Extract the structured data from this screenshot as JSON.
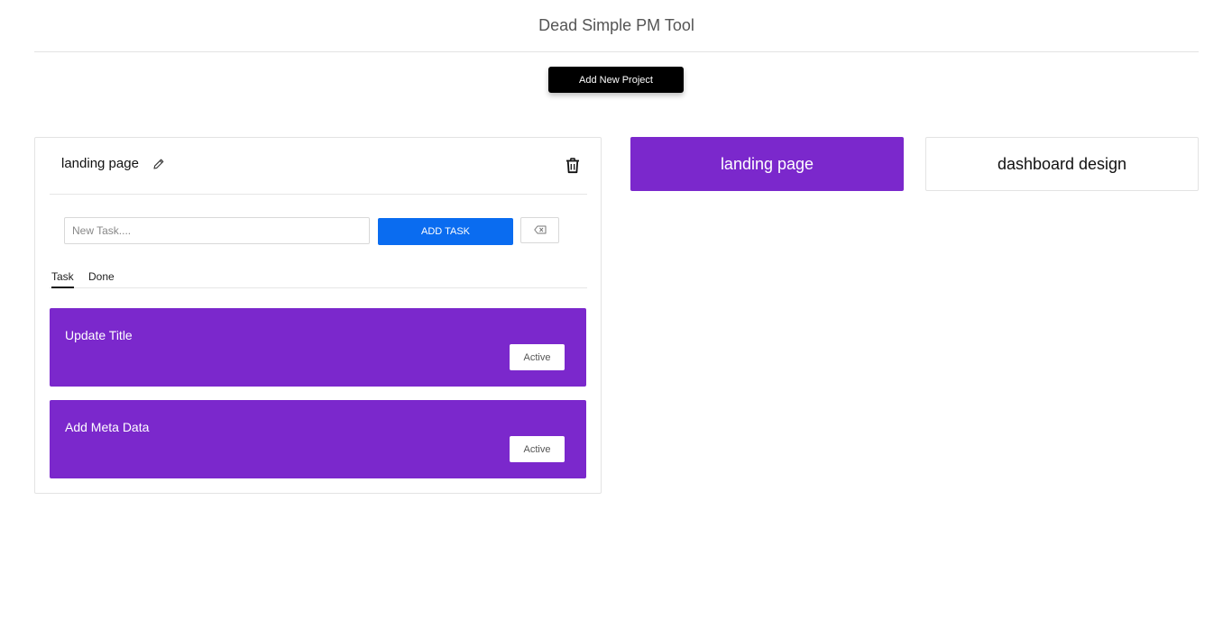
{
  "header": {
    "title": "Dead Simple PM Tool"
  },
  "toolbar": {
    "add_project_label": "Add New Project"
  },
  "project_panel": {
    "title": "landing page",
    "new_task_placeholder": "New Task....",
    "add_task_label": "ADD TASK",
    "tabs": [
      {
        "label": "Task",
        "active": true
      },
      {
        "label": "Done",
        "active": false
      }
    ],
    "tasks": [
      {
        "name": "Update Title",
        "status": "Active"
      },
      {
        "name": "Add Meta Data",
        "status": "Active"
      }
    ]
  },
  "projects": [
    {
      "name": "landing page",
      "selected": true
    },
    {
      "name": "dashboard design",
      "selected": false
    }
  ],
  "colors": {
    "accent_purple": "#7b28cc",
    "primary_blue": "#0a6cf0",
    "black": "#000000"
  },
  "icons": {
    "edit": "pencil-icon",
    "delete": "trash-icon",
    "clear": "backspace-icon"
  }
}
